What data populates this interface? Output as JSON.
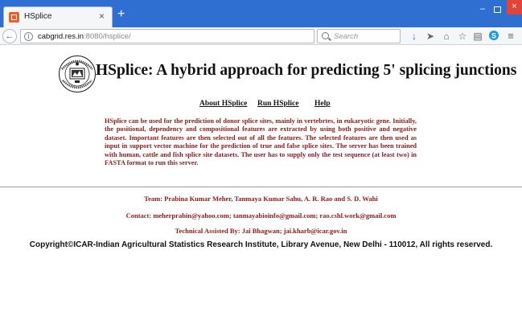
{
  "browser": {
    "tab_title": "HSplice",
    "tab_close": "×",
    "new_tab": "+",
    "url_host": "cabgrid.res.in",
    "url_rest": ":8080/hsplice/",
    "search_placeholder": "Search",
    "window_min": "–",
    "window_close": "×",
    "icons": [
      "download-icon",
      "send-icon",
      "home-icon",
      "star-icon",
      "clipboard-icon",
      "skype-icon",
      "menu-icon"
    ]
  },
  "page": {
    "heading": "HSplice: A hybrid approach for predicting 5' splicing junctions",
    "nav": {
      "about": "About HSplice",
      "run": "Run HSplice",
      "help": "Help"
    },
    "description": "HSplice can be used for the prediction of donor splice sites, mainly in vertebrtes, in eukaryotic gene. Initially, the positional, dependency and compositional features are extracted by using both positive and negative dataset. Important features are then selected out of all the features. The selected features are then used as input in support vector machine for the prediction of true and false splice sites. The server has been trained with human, cattle and fish splice site datasets. The user has to supply only the test sequence (at least two) in FASTA format to run this server.",
    "team": "Team: Prabina Kumar Meher, Tanmaya Kumar Sahu, A. R. Rao and S. D. Wahi",
    "contact": "Contact: meherprabin@yahoo.com; tanmayabioinfo@gmail.com; rao.cshl.work@gmail.com",
    "technical": "Technical Assisted By: Jai Bhagwan; jai.kharb@icar.gov.in",
    "copyright": "Copyright©ICAR-Indian Agricultural Statistics Research Institute, Library Avenue, New Delhi - 110012, All rights reserved."
  },
  "colors": {
    "tabstrip": "#2f6fd1",
    "credit_text": "#8b1a1a",
    "close_button": "#e0443a"
  }
}
